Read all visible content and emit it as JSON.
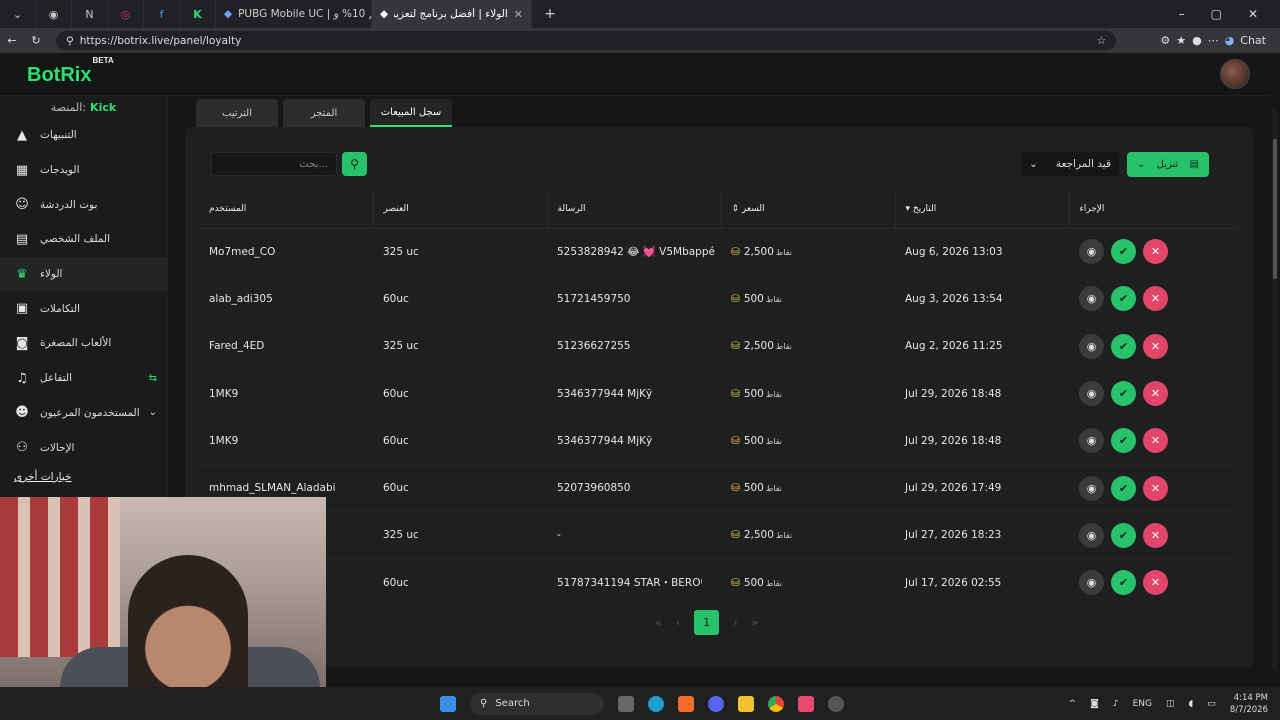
{
  "browser": {
    "tabs": [
      {
        "label": "PUBG Mobile UC | خصم 10% و...",
        "active": false
      },
      {
        "label": "الولاء | أفضل برنامج لتعزيز البث المباشر",
        "active": true
      }
    ],
    "url": "https://botrix.live/panel/loyalty",
    "chat_label": "Chat"
  },
  "app": {
    "logo": "BotRix",
    "logo_badge": "BETA",
    "platform_label": "المنصة:",
    "platform_value": "Kick"
  },
  "sidebar": {
    "items": [
      {
        "label": "التنبيهات",
        "icon": "warning-icon"
      },
      {
        "label": "الويدجات",
        "icon": "widgets-icon"
      },
      {
        "label": "بوت الدردشة",
        "icon": "robot-icon"
      },
      {
        "label": "الملف الشخصي",
        "icon": "profile-card-icon"
      },
      {
        "label": "الولاء",
        "icon": "trophy-icon",
        "active": true
      },
      {
        "label": "التكاملات",
        "icon": "puzzle-icon"
      },
      {
        "label": "الألعاب المصغرة",
        "icon": "gamepad-icon"
      },
      {
        "label": "التفاعل",
        "icon": "music-icon"
      },
      {
        "label": "المستخدمون المرعيون",
        "icon": "users-icon"
      },
      {
        "label": "الإحالات",
        "icon": "referrals-icon"
      }
    ],
    "more_options": "خيارات أخرى"
  },
  "tabs": [
    {
      "label": "الترتيب"
    },
    {
      "label": "المتجر"
    },
    {
      "label": "سجل المبيعات",
      "active": true
    }
  ],
  "toolbar": {
    "search_placeholder": "...بحث",
    "status_value": "قيد المراجعة",
    "download_label": "تنزيل"
  },
  "table": {
    "headers": {
      "user": "المستخدم",
      "item": "العنصر",
      "message": "الرسالة",
      "price": "السعر",
      "date": "التاريخ",
      "action": "الإجراء"
    },
    "price_unit": "نقاط",
    "rows": [
      {
        "user": "Mo7med_CO",
        "item": "325 uc",
        "message": "5253828942 😂 💓 V5Mbappé",
        "price": "2,500",
        "date": "Aug 6, 2026 13:03"
      },
      {
        "user": "alab_adi305",
        "item": "60uc",
        "message": "51721459750",
        "price": "500",
        "date": "Aug 3, 2026 13:54"
      },
      {
        "user": "Fared_4ED",
        "item": "325 uc",
        "message": "51236627255",
        "price": "2,500",
        "date": "Aug 2, 2026 11:25"
      },
      {
        "user": "1MK9",
        "item": "60uc",
        "message": "5346377944 MjKў",
        "price": "500",
        "date": "Jul 29, 2026 18:48"
      },
      {
        "user": "1MK9",
        "item": "60uc",
        "message": "5346377944 MjKў",
        "price": "500",
        "date": "Jul 29, 2026 18:48"
      },
      {
        "user": "mhmad_SLMAN_Aladabi",
        "item": "60uc",
        "message": "52073960850",
        "price": "500",
        "date": "Jul 29, 2026 17:49"
      },
      {
        "user": "",
        "item": "325 uc",
        "message": "-",
        "price": "2,500",
        "date": "Jul 27, 2026 18:23"
      },
      {
        "user": "",
        "item": "60uc",
        "message": "51787341194 STAR・BEROᵎ",
        "price": "500",
        "date": "Jul 17, 2026 02:55"
      }
    ]
  },
  "pagination": {
    "current": "1"
  },
  "taskbar": {
    "search": "Search",
    "lang": "ENG",
    "time": "4:14 PM",
    "date": "8/7/2026"
  },
  "colors": {
    "accent": "#2ee06f",
    "button_green": "#27c26a",
    "danger": "#e2456a"
  }
}
